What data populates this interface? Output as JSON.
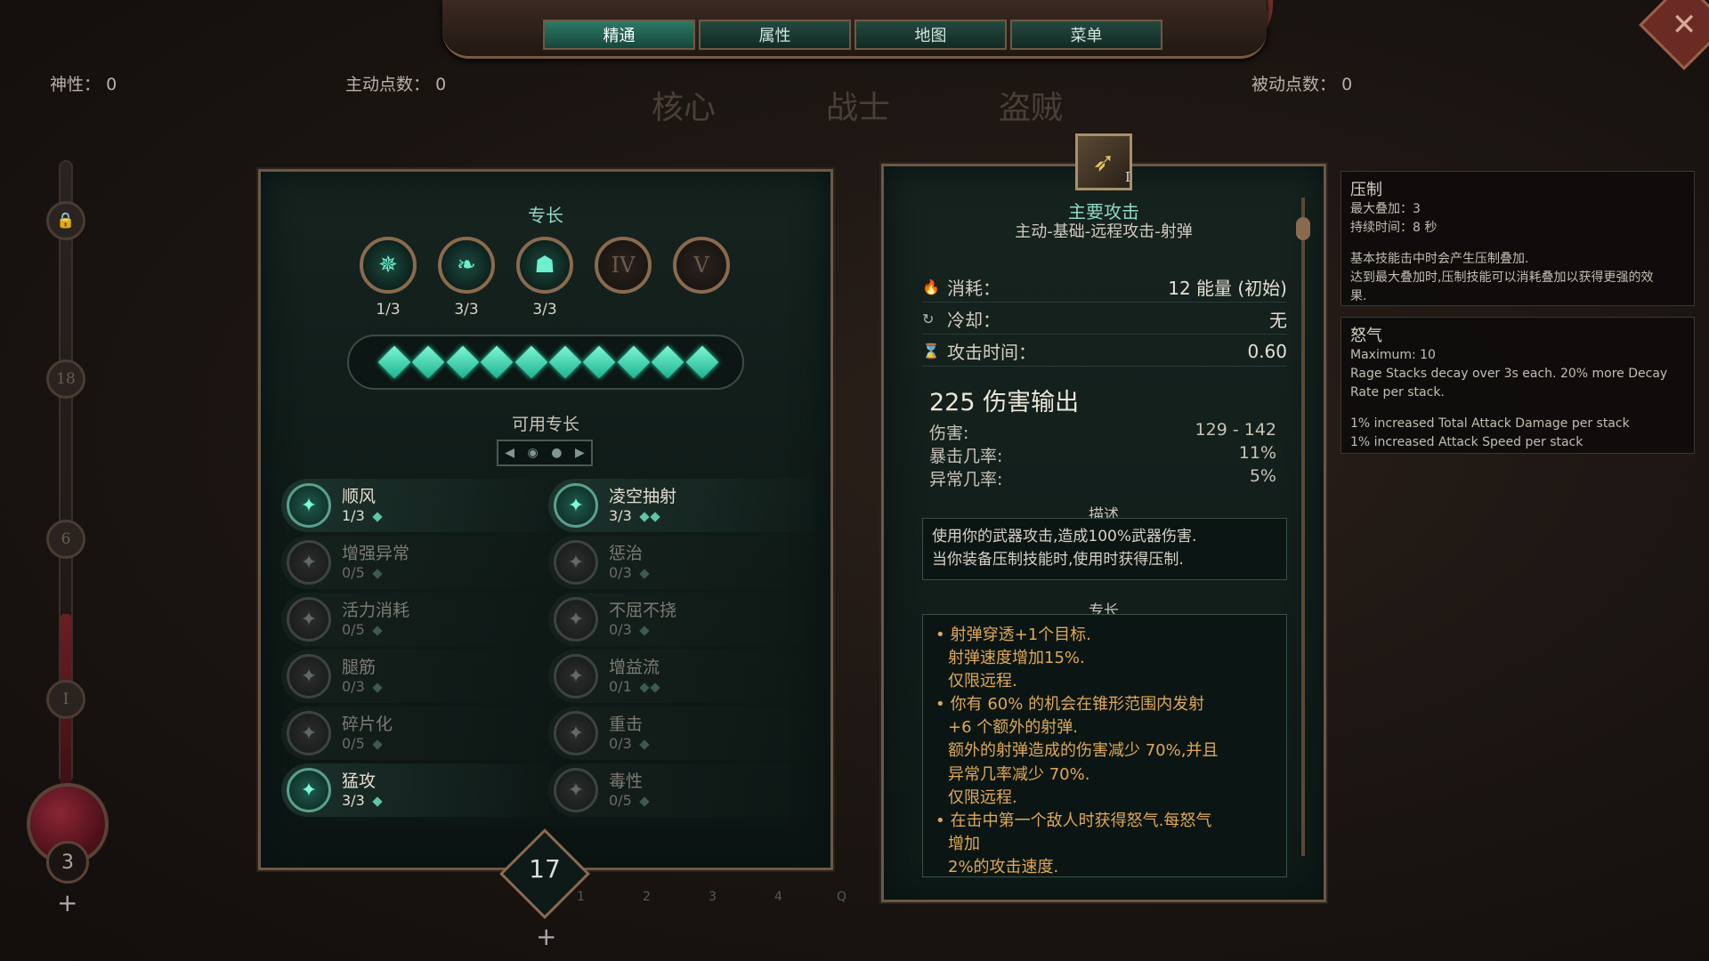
{
  "nav": {
    "tabs": [
      {
        "label": "精通",
        "active": true
      },
      {
        "label": "属性",
        "active": false
      },
      {
        "label": "地图",
        "active": false
      },
      {
        "label": "菜单",
        "active": false
      }
    ]
  },
  "header": {
    "divinity_label": "神性：",
    "divinity_value": "0",
    "active_points_label": "主动点数：",
    "active_points_value": "0",
    "passive_points_label": "被动点数：",
    "passive_points_value": "0",
    "categories": [
      "核心",
      "战士",
      "盗贼"
    ]
  },
  "rail": {
    "nodes": [
      "18",
      "6",
      "I"
    ],
    "orb_level": "3"
  },
  "specialties_panel": {
    "title": "专长",
    "ranks": [
      {
        "label": "",
        "count": "1/3",
        "locked": false,
        "icon": "leaf-burst-icon"
      },
      {
        "label": "",
        "count": "3/3",
        "locked": false,
        "icon": "wing-icon"
      },
      {
        "label": "",
        "count": "3/3",
        "locked": false,
        "icon": "head-icon"
      },
      {
        "label": "IV",
        "count": "",
        "locked": true
      },
      {
        "label": "V",
        "count": "",
        "locked": true
      }
    ],
    "gem_count": 10,
    "available_title": "可用专长",
    "skills_left": [
      {
        "name": "顺风",
        "rank": "1/3",
        "pips": 1,
        "active": true,
        "icon": "wind-icon"
      },
      {
        "name": "增强异常",
        "rank": "0/5",
        "pips": 1,
        "active": false,
        "icon": "skull-icon"
      },
      {
        "name": "活力消耗",
        "rank": "0/5",
        "pips": 1,
        "active": false,
        "icon": "sun-icon"
      },
      {
        "name": "腿筋",
        "rank": "0/3",
        "pips": 1,
        "active": false,
        "icon": "claw-icon"
      },
      {
        "name": "碎片化",
        "rank": "0/5",
        "pips": 1,
        "active": false,
        "icon": "shatter-icon"
      },
      {
        "name": "猛攻",
        "rank": "3/3",
        "pips": 1,
        "active": true,
        "icon": "charge-icon"
      }
    ],
    "skills_right": [
      {
        "name": "凌空抽射",
        "rank": "3/3",
        "pips": 2,
        "active": true,
        "icon": "volley-icon"
      },
      {
        "name": "惩治",
        "rank": "0/3",
        "pips": 1,
        "active": false,
        "icon": "punish-icon"
      },
      {
        "name": "不屈不挠",
        "rank": "0/3",
        "pips": 1,
        "active": false,
        "icon": "resolve-icon"
      },
      {
        "name": "增益流",
        "rank": "0/1",
        "pips": 2,
        "active": false,
        "icon": "flow-icon"
      },
      {
        "name": "重击",
        "rank": "0/3",
        "pips": 1,
        "active": false,
        "icon": "heavy-blow-icon"
      },
      {
        "name": "毒性",
        "rank": "0/5",
        "pips": 1,
        "active": false,
        "icon": "poison-icon"
      }
    ],
    "level": "17",
    "plus": "+"
  },
  "hotbar": [
    "1",
    "2",
    "3",
    "4",
    "Q"
  ],
  "skill_detail": {
    "emblem_icon": "bow-icon",
    "emblem_numeral": "I",
    "title": "主要攻击",
    "tags": "主动-基础-远程攻击-射弹",
    "cost_label": "消耗：",
    "cost_value": "12 能量 (初始)",
    "cooldown_label": "冷却：",
    "cooldown_value": "无",
    "attack_time_label": "攻击时间：",
    "attack_time_value": "0.60",
    "dps": "225 伤害输出",
    "damage_label": "伤害:",
    "damage_value": "129 - 142",
    "crit_label": "暴击几率:",
    "crit_value": "11%",
    "ailment_label": "异常几率:",
    "ailment_value": "5%",
    "description_title": "描述",
    "description_lines": [
      "使用你的武器攻击,造成100%武器伤害.",
      "当你装备压制技能时,使用时获得压制."
    ],
    "specialty_title": "专长",
    "specialty_lines": [
      {
        "text": "射弹穿透+1个目标.",
        "bullet": true
      },
      {
        "text": "射弹速度增加15%.",
        "bullet": false
      },
      {
        "text": "仅限远程.",
        "bullet": false
      },
      {
        "text": "你有 60% 的机会在锥形范围内发射",
        "bullet": true
      },
      {
        "text": "+6 个额外的射弹.",
        "bullet": false
      },
      {
        "text": "额外的射弹造成的伤害减少 70%,并且",
        "bullet": false
      },
      {
        "text": "异常几率减少 70%.",
        "bullet": false
      },
      {
        "text": "仅限远程.",
        "bullet": false
      },
      {
        "text": "在击中第一个敌人时获得怒气.每怒气",
        "bullet": true
      },
      {
        "text": "增加",
        "bullet": false
      },
      {
        "text": "2%的攻击速度.",
        "bullet": false
      }
    ]
  },
  "tooltips": [
    {
      "title": "压制",
      "lines": [
        "最大叠加：3",
        "持续时间：8 秒",
        "",
        "基本技能击中时会产生压制叠加.",
        "达到最大叠加时,压制技能可以消耗叠加以获得更强的效",
        "果."
      ]
    },
    {
      "title": "怒气",
      "lines": [
        "Maximum: 10",
        "Rage Stacks decay over 3s each. 20% more Decay",
        "Rate per stack.",
        "",
        "1% increased Total Attack Damage per stack",
        "1% increased Attack Speed per stack"
      ]
    }
  ],
  "colors": {
    "accent_teal": "#6ef0cf",
    "gold_text": "#e0a857",
    "frame_bronze": "#8a6a4e"
  }
}
